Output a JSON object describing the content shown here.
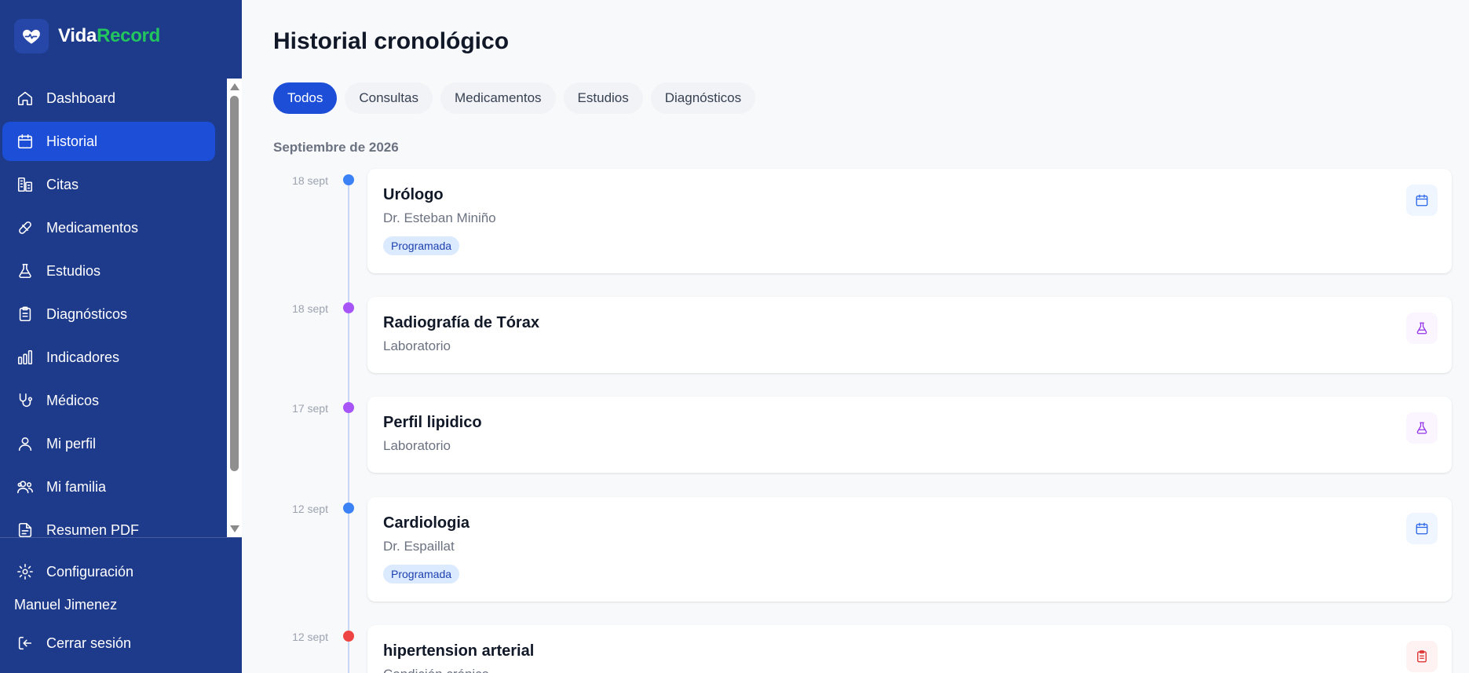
{
  "brand": {
    "name_part1": "Vida",
    "name_part2": "Record"
  },
  "sidebar": {
    "items": [
      {
        "label": "Dashboard",
        "icon": "home-icon"
      },
      {
        "label": "Historial",
        "icon": "calendar-icon",
        "active": true
      },
      {
        "label": "Citas",
        "icon": "building-icon"
      },
      {
        "label": "Medicamentos",
        "icon": "pill-icon"
      },
      {
        "label": "Estudios",
        "icon": "flask-icon"
      },
      {
        "label": "Diagnósticos",
        "icon": "clipboard-icon"
      },
      {
        "label": "Indicadores",
        "icon": "bar-chart-icon"
      },
      {
        "label": "Médicos",
        "icon": "stethoscope-icon"
      },
      {
        "label": "Mi perfil",
        "icon": "user-icon"
      },
      {
        "label": "Mi familia",
        "icon": "users-icon"
      },
      {
        "label": "Resumen PDF",
        "icon": "file-icon"
      }
    ],
    "settings_label": "Configuración",
    "user_name": "Manuel Jimenez",
    "logout_label": "Cerrar sesión"
  },
  "main": {
    "title": "Historial cronológico",
    "tabs": [
      {
        "label": "Todos",
        "active": true
      },
      {
        "label": "Consultas"
      },
      {
        "label": "Medicamentos"
      },
      {
        "label": "Estudios"
      },
      {
        "label": "Diagnósticos"
      }
    ],
    "section_label": "Septiembre de 2026",
    "entries": [
      {
        "date": "18 sept",
        "title": "Urólogo",
        "subtitle": "Dr. Esteban Miniño",
        "badge": "Programada",
        "dot_color": "#3b82f6",
        "icon": "calendar-icon",
        "icon_color": "#2563eb",
        "icon_bg": "#eff6ff"
      },
      {
        "date": "18 sept",
        "title": "Radiografía de Tórax",
        "subtitle": "Laboratorio",
        "dot_color": "#a855f7",
        "icon": "flask-icon",
        "icon_color": "#9333ea",
        "icon_bg": "#faf5ff"
      },
      {
        "date": "17 sept",
        "title": "Perfil lipidico",
        "subtitle": "Laboratorio",
        "dot_color": "#a855f7",
        "icon": "flask-icon",
        "icon_color": "#9333ea",
        "icon_bg": "#faf5ff"
      },
      {
        "date": "12 sept",
        "title": "Cardiologia",
        "subtitle": "Dr. Espaillat",
        "badge": "Programada",
        "dot_color": "#3b82f6",
        "icon": "calendar-icon",
        "icon_color": "#2563eb",
        "icon_bg": "#eff6ff"
      },
      {
        "date": "12 sept",
        "title": "hipertension arterial",
        "subtitle": "Condición crónica",
        "dot_color": "#ef4444",
        "icon": "clipboard-icon",
        "icon_color": "#dc2626",
        "icon_bg": "#fef2f2"
      }
    ]
  }
}
